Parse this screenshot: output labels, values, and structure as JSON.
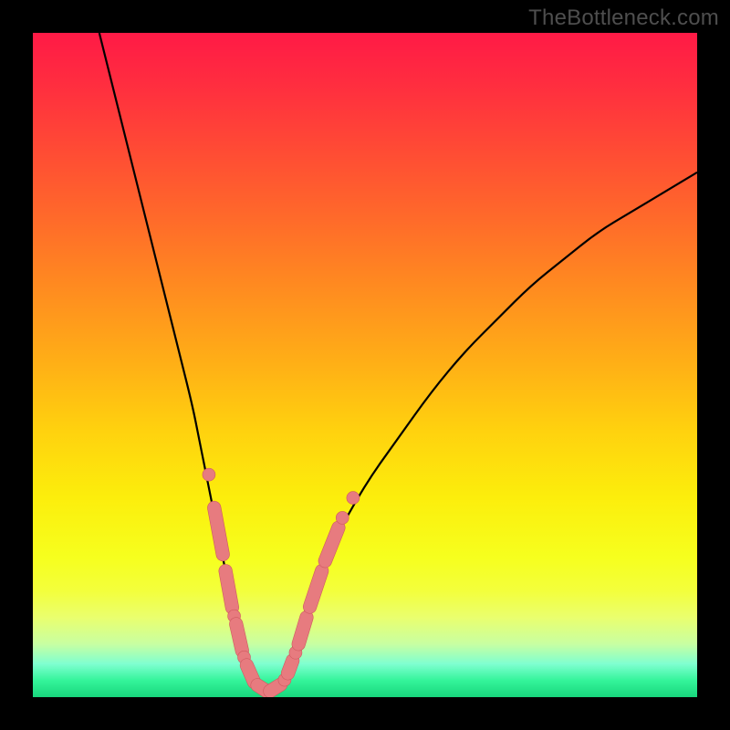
{
  "watermark": {
    "text": "TheBottleneck.com"
  },
  "colors": {
    "curve_stroke": "#000000",
    "marker_fill": "#e77b7f",
    "marker_stroke": "#cf5a5f"
  },
  "chart_data": {
    "type": "line",
    "title": "",
    "xlabel": "",
    "ylabel": "",
    "xlim": [
      0,
      100
    ],
    "ylim": [
      0,
      100
    ],
    "grid": false,
    "series": [
      {
        "name": "bottleneck-curve",
        "x": [
          10,
          12,
          14,
          16,
          18,
          20,
          22,
          24,
          25,
          26,
          27,
          28,
          29,
          30,
          31,
          32,
          33,
          34,
          35,
          36,
          37,
          38,
          39,
          40,
          42,
          45,
          50,
          55,
          60,
          65,
          70,
          75,
          80,
          85,
          90,
          95,
          100
        ],
        "y": [
          100,
          92,
          84,
          76,
          68,
          60,
          52,
          44,
          39,
          34,
          29,
          24,
          19,
          14,
          10,
          7,
          4,
          2,
          1,
          1,
          2,
          4,
          7,
          10,
          16,
          23,
          32,
          39,
          46,
          52,
          57,
          62,
          66,
          70,
          73,
          76,
          79
        ]
      }
    ],
    "markers": [
      {
        "type": "dot",
        "x": 26.5,
        "y": 33.5
      },
      {
        "type": "pill",
        "x1": 27.3,
        "y1": 28.5,
        "x2": 28.6,
        "y2": 21.5
      },
      {
        "type": "pill",
        "x1": 29.0,
        "y1": 19.0,
        "x2": 30.0,
        "y2": 13.5
      },
      {
        "type": "dot",
        "x": 30.3,
        "y": 12.2
      },
      {
        "type": "pill",
        "x1": 30.6,
        "y1": 11.0,
        "x2": 31.5,
        "y2": 7.0
      },
      {
        "type": "dot",
        "x": 31.8,
        "y": 6.0
      },
      {
        "type": "pill",
        "x1": 32.2,
        "y1": 4.8,
        "x2": 33.3,
        "y2": 2.3
      },
      {
        "type": "pill",
        "x1": 33.8,
        "y1": 1.8,
        "x2": 35.2,
        "y2": 0.9
      },
      {
        "type": "pill",
        "x1": 35.7,
        "y1": 0.9,
        "x2": 37.3,
        "y2": 1.9
      },
      {
        "type": "dot",
        "x": 37.9,
        "y": 2.6
      },
      {
        "type": "pill",
        "x1": 38.4,
        "y1": 3.6,
        "x2": 39.1,
        "y2": 5.5
      },
      {
        "type": "dot",
        "x": 39.55,
        "y": 6.7
      },
      {
        "type": "pill",
        "x1": 40.0,
        "y1": 8.0,
        "x2": 41.2,
        "y2": 12.0
      },
      {
        "type": "pill",
        "x1": 41.7,
        "y1": 13.6,
        "x2": 43.5,
        "y2": 19.0
      },
      {
        "type": "pill",
        "x1": 44.0,
        "y1": 20.5,
        "x2": 46.0,
        "y2": 25.5
      },
      {
        "type": "dot",
        "x": 46.6,
        "y": 27.0
      },
      {
        "type": "dot",
        "x": 48.2,
        "y": 30.0
      }
    ]
  }
}
